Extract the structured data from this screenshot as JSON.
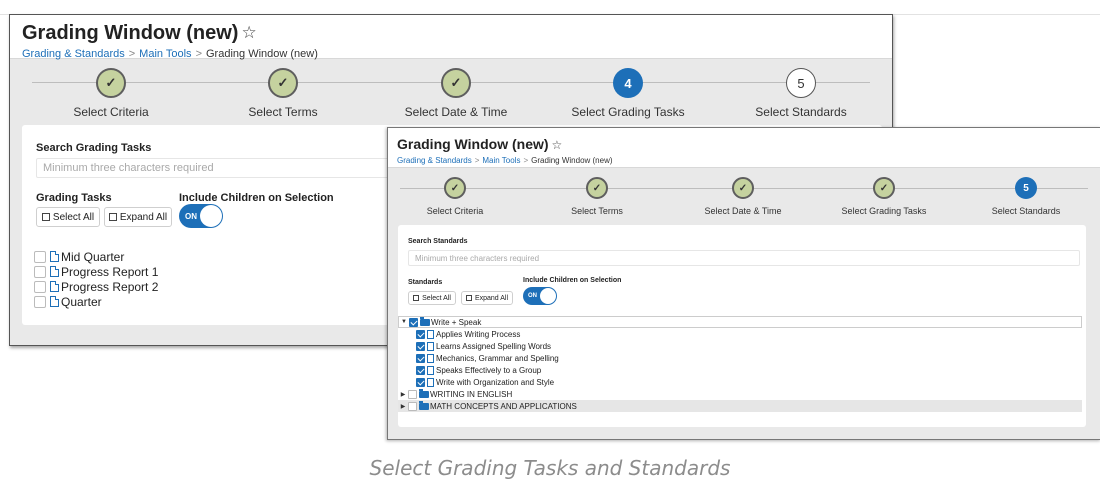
{
  "window1": {
    "title": "Grading Window (new)",
    "star_icon": "☆",
    "breadcrumb": [
      "Grading & Standards",
      "Main Tools",
      "Grading Window (new)"
    ],
    "steps": [
      {
        "number": "✓",
        "label": "Select Criteria",
        "state": "done"
      },
      {
        "number": "✓",
        "label": "Select Terms",
        "state": "done"
      },
      {
        "number": "✓",
        "label": "Select Date & Time",
        "state": "done"
      },
      {
        "number": "4",
        "label": "Select Grading Tasks",
        "state": "active"
      },
      {
        "number": "5",
        "label": "Select Standards",
        "state": "todo"
      }
    ],
    "search_label": "Search Grading Tasks",
    "search_placeholder": "Minimum three characters required",
    "list_label": "Grading Tasks",
    "children_label": "Include Children on Selection",
    "select_all": "Select All",
    "expand_all": "Expand All",
    "toggle": "ON",
    "tasks": [
      "Mid Quarter",
      "Progress Report 1",
      "Progress Report 2",
      "Quarter"
    ]
  },
  "window2": {
    "title": "Grading Window (new)",
    "star_icon": "☆",
    "breadcrumb": [
      "Grading & Standards",
      "Main Tools",
      "Grading Window (new)"
    ],
    "steps": [
      {
        "number": "✓",
        "label": "Select Criteria",
        "state": "done"
      },
      {
        "number": "✓",
        "label": "Select Terms",
        "state": "done"
      },
      {
        "number": "✓",
        "label": "Select Date & Time",
        "state": "done"
      },
      {
        "number": "✓",
        "label": "Select Grading Tasks",
        "state": "done"
      },
      {
        "number": "5",
        "label": "Select Standards",
        "state": "active"
      }
    ],
    "search_label": "Search Standards",
    "search_placeholder": "Minimum three characters required",
    "list_label": "Standards",
    "children_label": "Include Children on Selection",
    "select_all": "Select All",
    "expand_all": "Expand All",
    "toggle": "ON",
    "tree": [
      {
        "label": "Write + Speak",
        "type": "folder",
        "level": 0,
        "expanded": true,
        "checked": true
      },
      {
        "label": "Applies Writing Process",
        "type": "doc",
        "level": 1,
        "checked": true
      },
      {
        "label": "Learns Assigned Spelling Words",
        "type": "doc",
        "level": 1,
        "checked": true
      },
      {
        "label": "Mechanics, Grammar and Spelling",
        "type": "doc",
        "level": 1,
        "checked": true
      },
      {
        "label": "Speaks Effectively to a Group",
        "type": "doc",
        "level": 1,
        "checked": true
      },
      {
        "label": "Write with Organization and Style",
        "type": "doc",
        "level": 1,
        "checked": true
      },
      {
        "label": "WRITING IN ENGLISH",
        "type": "folder",
        "level": 0,
        "expanded": false,
        "checked": false
      },
      {
        "label": "MATH CONCEPTS AND APPLICATIONS",
        "type": "folder",
        "level": 0,
        "expanded": false,
        "checked": false,
        "highlighted": true
      }
    ]
  },
  "caption": "Select Grading Tasks and Standards",
  "colors": {
    "accent": "#1d6fb8",
    "step_done": "#c5d29f",
    "panel_bg": "#e9e9e9",
    "caption": "#8c8c8c"
  }
}
